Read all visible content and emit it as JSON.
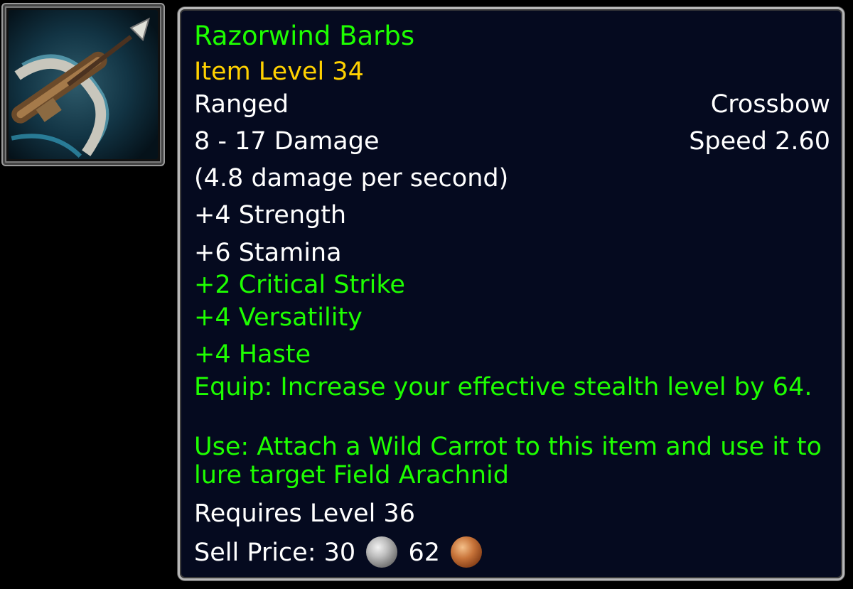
{
  "item": {
    "name": "Razorwind Barbs",
    "item_level": "Item Level 34",
    "slot": "Ranged",
    "type": "Crossbow",
    "damage": "8 - 17 Damage",
    "speed": "Speed 2.60",
    "dps": "(4.8 damage per second)",
    "stats_white": [
      "+4 Strength",
      "+6 Stamina"
    ],
    "stats_green": [
      "+2 Critical Strike",
      "+4 Versatility",
      "+4 Haste"
    ],
    "equip": "Equip: Increase your effective stealth level by 64.",
    "use": "Use: Attach a Wild Carrot to this item and use it to lure target Field Arachnid",
    "requires": "Requires Level 36",
    "sell_label": "Sell Price: 30",
    "copper_amount": "62",
    "icon": "crossbow-icon"
  },
  "colors": {
    "name": "#1eff00",
    "item_level": "#ffd100",
    "text": "#ffffff",
    "bonus": "#1eff00",
    "background": "#050a1f",
    "border": "#b8b8b8"
  },
  "coins": [
    "silver-coin-icon",
    "copper-coin-icon"
  ]
}
